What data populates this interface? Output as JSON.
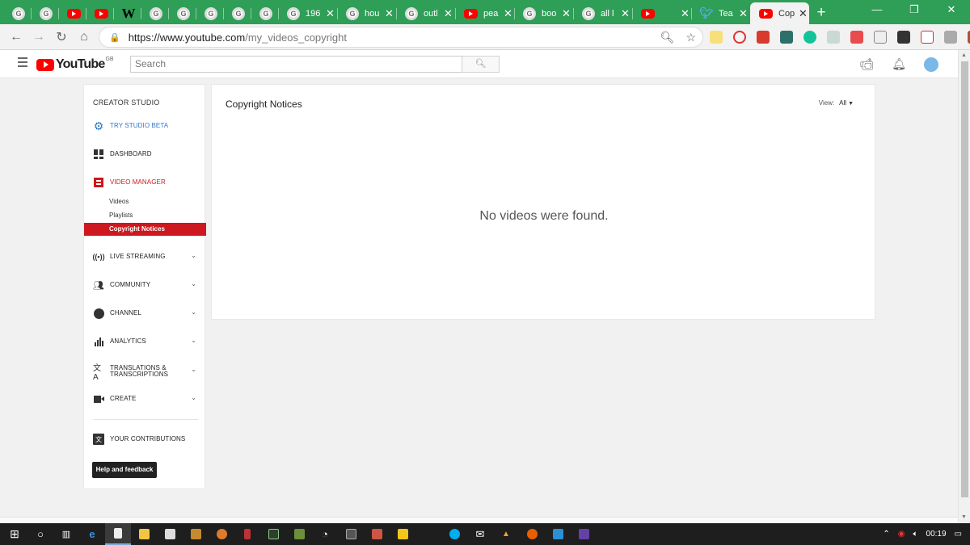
{
  "browser": {
    "tabs": [
      {
        "icon": "google-icon",
        "label": "",
        "closable": false
      },
      {
        "icon": "google-icon",
        "label": "",
        "closable": false
      },
      {
        "icon": "youtube-icon",
        "label": "",
        "closable": false
      },
      {
        "icon": "youtube-icon",
        "label": "",
        "closable": false
      },
      {
        "icon": "wikipedia-icon",
        "label": "",
        "closable": false
      },
      {
        "icon": "google-icon",
        "label": "",
        "closable": false
      },
      {
        "icon": "google-icon",
        "label": "",
        "closable": false
      },
      {
        "icon": "google-icon",
        "label": "",
        "closable": false
      },
      {
        "icon": "google-icon",
        "label": "",
        "closable": false
      },
      {
        "icon": "google-icon",
        "label": "",
        "closable": false
      },
      {
        "icon": "google-icon",
        "label": "196",
        "closable": true
      },
      {
        "icon": "google-icon",
        "label": "hou",
        "closable": true
      },
      {
        "icon": "google-icon",
        "label": "outl",
        "closable": true
      },
      {
        "icon": "youtube-icon",
        "label": "pea",
        "closable": true
      },
      {
        "icon": "google-icon",
        "label": "boo",
        "closable": true
      },
      {
        "icon": "google-icon",
        "label": "all l",
        "closable": true
      },
      {
        "icon": "youtube-icon",
        "label": "",
        "closable": true
      },
      {
        "icon": "twitter-icon",
        "label": "Tea",
        "closable": true
      },
      {
        "icon": "youtube-icon",
        "label": "Cop",
        "closable": true,
        "active": true
      }
    ],
    "new_tab_label": "+",
    "window_controls": {
      "minimize": "—",
      "restore": "❐",
      "close": "✕"
    },
    "url_host": "https://www.youtube.com",
    "url_path": "/my_videos_copyright"
  },
  "masthead": {
    "logo_text": "YouTube",
    "region": "GB",
    "search_placeholder": "Search"
  },
  "sidebar": {
    "section_title": "CREATOR STUDIO",
    "try_beta": "TRY STUDIO BETA",
    "dashboard": "DASHBOARD",
    "video_manager": "VIDEO MANAGER",
    "sub_items": [
      "Videos",
      "Playlists",
      "Copyright Notices"
    ],
    "live_streaming": "LIVE STREAMING",
    "community": "COMMUNITY",
    "channel": "CHANNEL",
    "analytics": "ANALYTICS",
    "translations_line1": "TRANSLATIONS &",
    "translations_line2": "TRANSCRIPTIONS",
    "create": "CREATE",
    "your_contributions": "YOUR CONTRIBUTIONS",
    "help_button": "Help and feedback"
  },
  "main": {
    "title": "Copyright Notices",
    "view_label": "View:",
    "view_value": "All",
    "empty_message": "No videos were found."
  },
  "taskbar": {
    "clock": "00:19"
  },
  "colors": {
    "chrome_frame": "#2f9e57",
    "youtube_red": "#cc181e",
    "studio_beta_blue": "#2e77c8"
  }
}
